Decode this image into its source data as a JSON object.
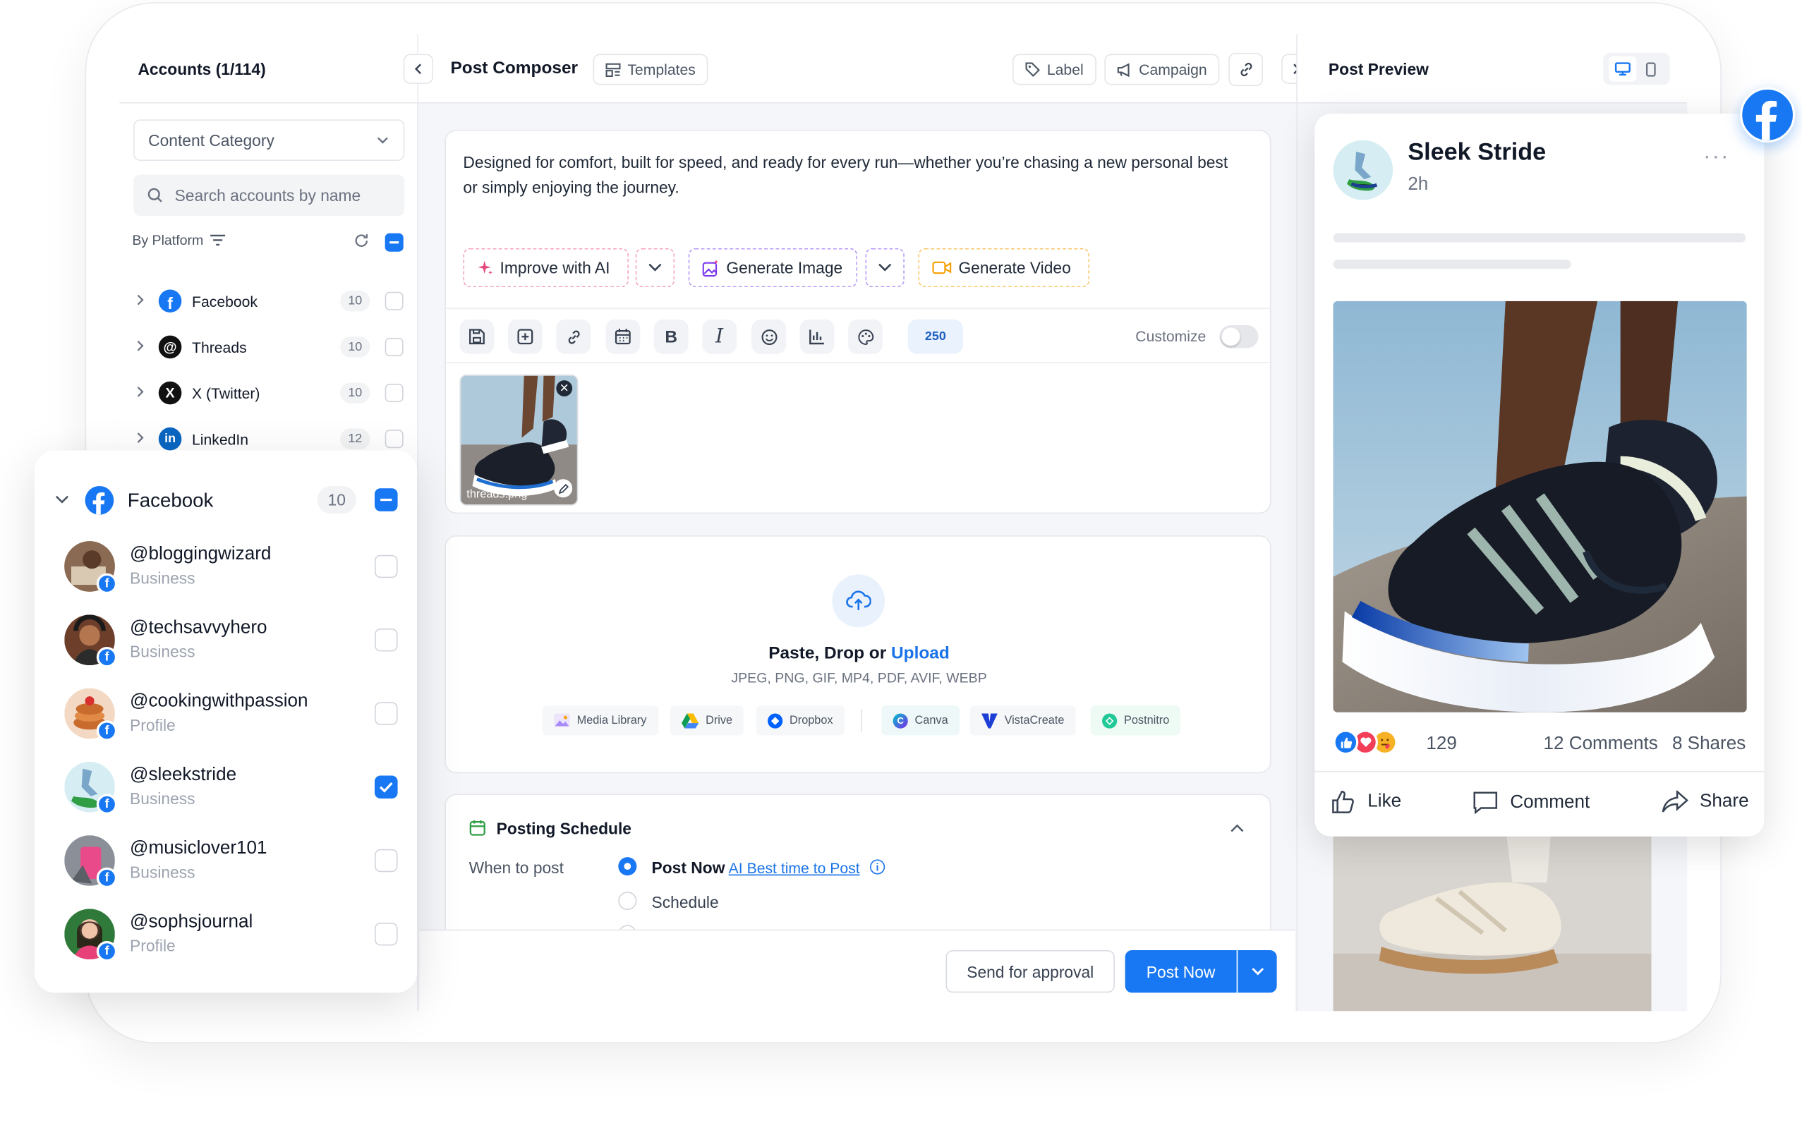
{
  "left_panel": {
    "title": "Accounts (1/114)",
    "content_category": "Content Category",
    "search_placeholder": "Search accounts by name",
    "by_platform": "By Platform",
    "platforms": [
      {
        "name": "Facebook",
        "count": "10"
      },
      {
        "name": "Threads",
        "count": "10"
      },
      {
        "name": "X (Twitter)",
        "count": "10"
      },
      {
        "name": "LinkedIn",
        "count": "12"
      }
    ]
  },
  "popup": {
    "platform": "Facebook",
    "count": "10",
    "accounts": [
      {
        "handle": "@bloggingwizard",
        "type": "Business",
        "checked": false
      },
      {
        "handle": "@techsavvyhero",
        "type": "Business",
        "checked": false
      },
      {
        "handle": "@cookingwithpassion",
        "type": "Profile",
        "checked": false
      },
      {
        "handle": "@sleekstride",
        "type": "Business",
        "checked": true
      },
      {
        "handle": "@musiclover101",
        "type": "Business",
        "checked": false
      },
      {
        "handle": "@sophsjournal",
        "type": "Profile",
        "checked": false
      }
    ]
  },
  "composer": {
    "title": "Post Composer",
    "templates": "Templates",
    "label": "Label",
    "campaign": "Campaign",
    "post_text": "Designed for comfort, built for speed, and ready for every run—whether you’re chasing a new personal best or simply enjoying the journey.",
    "ai_improve": "Improve with AI",
    "generate_image": "Generate Image",
    "generate_video": "Generate Video",
    "char_count": "250",
    "customize": "Customize",
    "attachment_name": "threads.png",
    "upload": {
      "paste_drop": "Paste, Drop or ",
      "upload_link": "Upload",
      "formats": "JPEG, PNG, GIF, MP4, PDF, AVIF, WEBP",
      "sources": [
        "Media Library",
        "Drive",
        "Dropbox",
        "Canva",
        "VistaCreate",
        "Postnitro"
      ]
    },
    "schedule": {
      "title": "Posting Schedule",
      "when_label": "When to post",
      "post_now": "Post Now",
      "ai_best_time": "AI Best time to Post",
      "schedule_option": "Schedule"
    },
    "send_approval": "Send for approval",
    "post_now_button": "Post Now"
  },
  "preview": {
    "title": "Post Preview",
    "page_name": "Sleek Stride",
    "time_ago": "2h",
    "reactions": "129",
    "comments": "12 Comments",
    "shares": "8 Shares",
    "like": "Like",
    "comment": "Comment",
    "share": "Share"
  },
  "colors": {
    "brand_blue": "#1877f2",
    "link_blue": "#1a73e8",
    "ai_pink": "#e64980",
    "image_purple": "#7c3aed",
    "video_orange": "#f59f00"
  }
}
